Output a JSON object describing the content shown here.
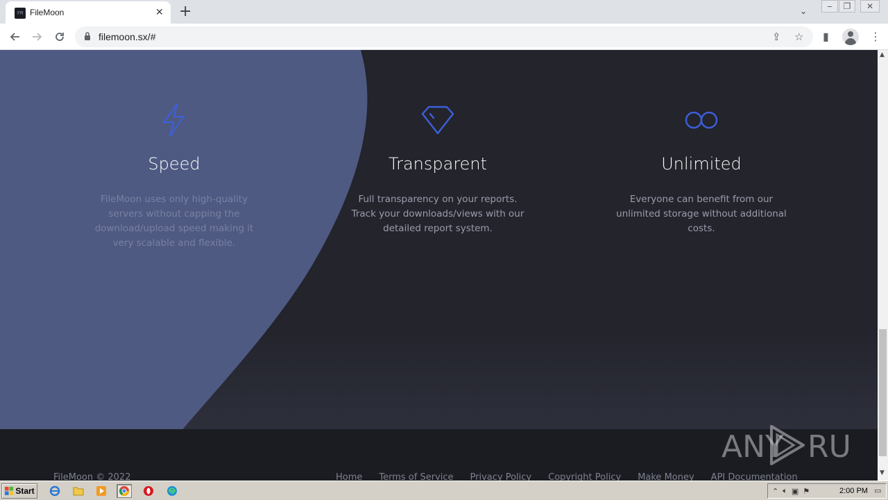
{
  "browser": {
    "tab_title": "FileMoon",
    "favicon_text": "FM",
    "url": "filemoon.sx/#"
  },
  "features": [
    {
      "icon": "lightning-icon",
      "title": "Speed",
      "description": "FileMoon uses only high-quality servers without capping the download/upload speed making it very scalable and flexible."
    },
    {
      "icon": "diamond-icon",
      "title": "Transparent",
      "description": "Full transparency on your reports. Track your downloads/views with our detailed report system."
    },
    {
      "icon": "infinity-icon",
      "title": "Unlimited",
      "description": "Everyone can benefit from our unlimited storage without additional costs."
    }
  ],
  "footer": {
    "copyright": "FileMoon © 2022",
    "links": [
      "Home",
      "Terms of Service",
      "Privacy Policy",
      "Copyright Policy",
      "Make Money",
      "API Documentation"
    ]
  },
  "watermark": "ANY RUN",
  "taskbar": {
    "start_label": "Start",
    "clock": "2:00 PM"
  },
  "colors": {
    "accent": "#3d5fd9",
    "blob": "#4e5a82",
    "background": "#23242c"
  }
}
